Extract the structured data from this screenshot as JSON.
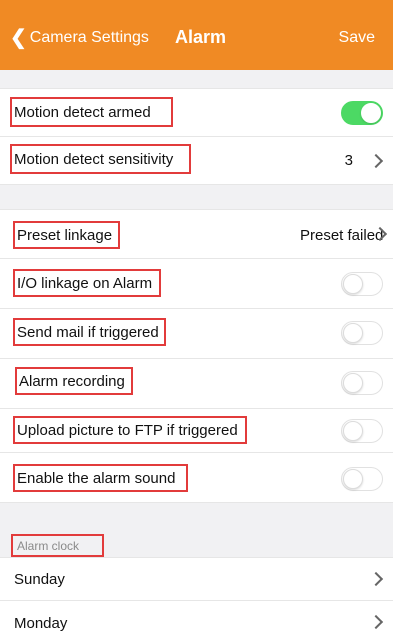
{
  "navbar": {
    "back_label": "Camera Settings",
    "title": "Alarm",
    "save_label": "Save",
    "color": "#f08a24"
  },
  "rows": {
    "motion_armed": {
      "label": "Motion detect armed",
      "toggle_on": true
    },
    "motion_sensitivity": {
      "label": "Motion detect sensitivity",
      "value": "3"
    },
    "preset_linkage": {
      "label": "Preset linkage",
      "value": "Preset failed"
    },
    "io_linkage": {
      "label": "I/O linkage on Alarm",
      "toggle_on": false
    },
    "send_mail": {
      "label": "Send mail if triggered",
      "toggle_on": false
    },
    "alarm_recording": {
      "label": "Alarm recording",
      "toggle_on": false
    },
    "upload_ftp": {
      "label": "Upload picture to FTP if triggered",
      "toggle_on": false
    },
    "alarm_sound": {
      "label": "Enable the alarm sound",
      "toggle_on": false
    }
  },
  "alarm_clock": {
    "header": "Alarm clock",
    "days": [
      "Sunday",
      "Monday"
    ]
  },
  "colors": {
    "toggle_on": "#4cd964",
    "highlight_box": "#e23b3b",
    "section_bg": "#f1f1f3"
  }
}
